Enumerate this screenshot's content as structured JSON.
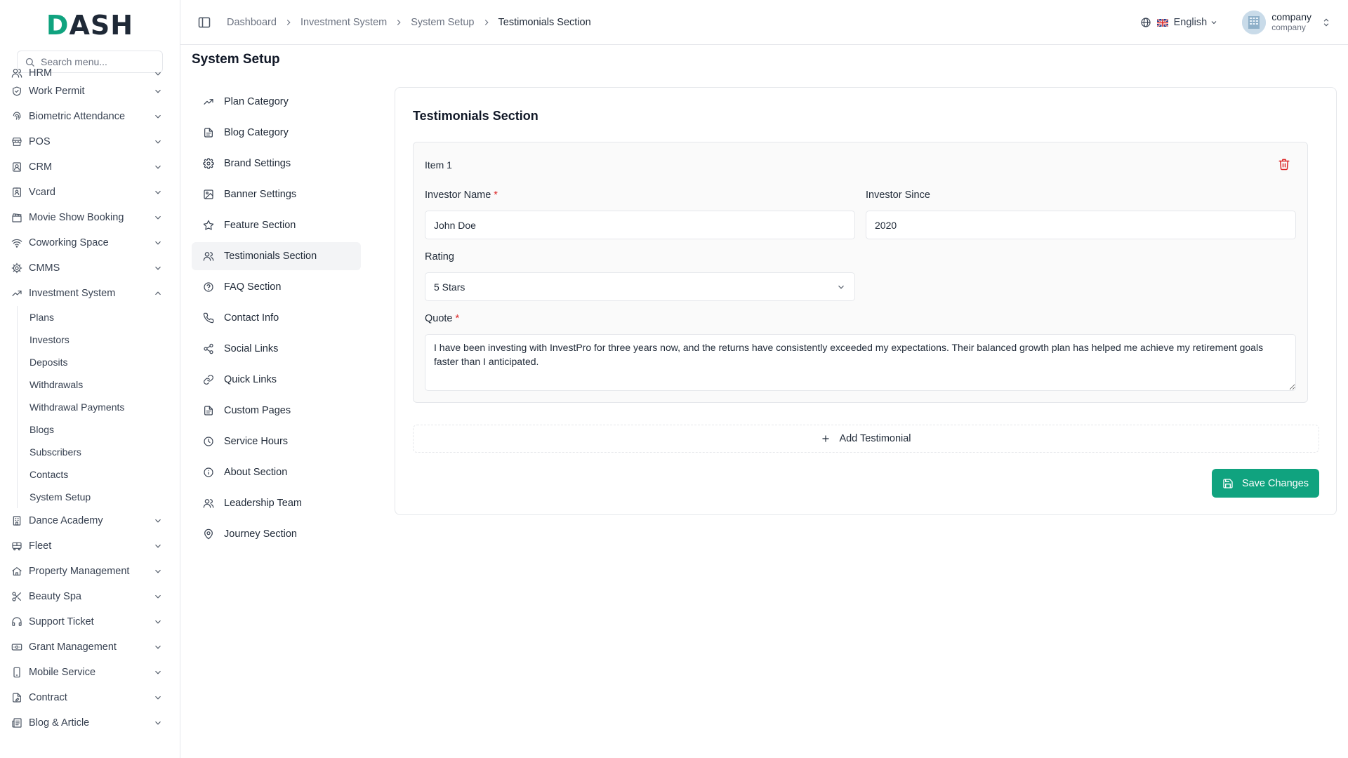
{
  "brand": {
    "logo_text": "DASH",
    "accent_color": "#10a37f"
  },
  "sidebar": {
    "search_placeholder": "Search menu...",
    "partial_item": "HRM",
    "items_top": [
      {
        "label": "Work Permit",
        "icon": "shield-check-icon"
      },
      {
        "label": "Biometric Attendance",
        "icon": "fingerprint-icon"
      },
      {
        "label": "POS",
        "icon": "store-icon"
      },
      {
        "label": "CRM",
        "icon": "contact-icon"
      },
      {
        "label": "Vcard",
        "icon": "id-card-icon"
      },
      {
        "label": "Movie Show Booking",
        "icon": "clapperboard-icon"
      },
      {
        "label": "Coworking Space",
        "icon": "wifi-icon"
      },
      {
        "label": "CMMS",
        "icon": "cog-icon"
      }
    ],
    "active_group": {
      "label": "Investment System",
      "icon": "trending-up-icon",
      "children": [
        "Plans",
        "Investors",
        "Deposits",
        "Withdrawals",
        "Withdrawal Payments",
        "Blogs",
        "Subscribers",
        "Contacts",
        "System Setup"
      ]
    },
    "items_bottom": [
      {
        "label": "Dance Academy",
        "icon": "building-icon"
      },
      {
        "label": "Fleet",
        "icon": "bus-icon"
      },
      {
        "label": "Property Management",
        "icon": "home-icon"
      },
      {
        "label": "Beauty Spa",
        "icon": "scissors-icon"
      },
      {
        "label": "Support Ticket",
        "icon": "headphones-icon"
      },
      {
        "label": "Grant Management",
        "icon": "banknote-icon"
      },
      {
        "label": "Mobile Service",
        "icon": "smartphone-icon"
      },
      {
        "label": "Contract",
        "icon": "file-pen-icon"
      },
      {
        "label": "Blog & Article",
        "icon": "newspaper-icon"
      }
    ]
  },
  "header": {
    "breadcrumb": [
      "Dashboard",
      "Investment System",
      "System Setup",
      "Testimonials Section"
    ],
    "language": "English",
    "user": {
      "name": "company",
      "role": "company"
    }
  },
  "page": {
    "title": "System Setup"
  },
  "settings_nav": [
    {
      "label": "Plan Category",
      "icon": "trending-up-icon"
    },
    {
      "label": "Blog Category",
      "icon": "file-text-icon"
    },
    {
      "label": "Brand Settings",
      "icon": "settings-icon"
    },
    {
      "label": "Banner Settings",
      "icon": "image-icon"
    },
    {
      "label": "Feature Section",
      "icon": "star-icon"
    },
    {
      "label": "Testimonials Section",
      "icon": "users-icon",
      "active": true
    },
    {
      "label": "FAQ Section",
      "icon": "help-circle-icon"
    },
    {
      "label": "Contact Info",
      "icon": "phone-icon"
    },
    {
      "label": "Social Links",
      "icon": "share-icon"
    },
    {
      "label": "Quick Links",
      "icon": "link-icon"
    },
    {
      "label": "Custom Pages",
      "icon": "file-text-icon"
    },
    {
      "label": "Service Hours",
      "icon": "clock-icon"
    },
    {
      "label": "About Section",
      "icon": "info-icon"
    },
    {
      "label": "Leadership Team",
      "icon": "users-icon"
    },
    {
      "label": "Journey Section",
      "icon": "map-pin-icon"
    }
  ],
  "form": {
    "title": "Testimonials Section",
    "item_title": "Item 1",
    "investor_name_label": "Investor Name",
    "investor_name_value": "John Doe",
    "investor_since_label": "Investor Since",
    "investor_since_value": "2020",
    "rating_label": "Rating",
    "rating_value": "5 Stars",
    "quote_label": "Quote",
    "quote_value": "I have been investing with InvestPro for three years now, and the returns have consistently exceeded my expectations. Their balanced growth plan has helped me achieve my retirement goals faster than I anticipated.",
    "required_mark": "*",
    "add_label": "Add Testimonial",
    "save_label": "Save Changes"
  }
}
